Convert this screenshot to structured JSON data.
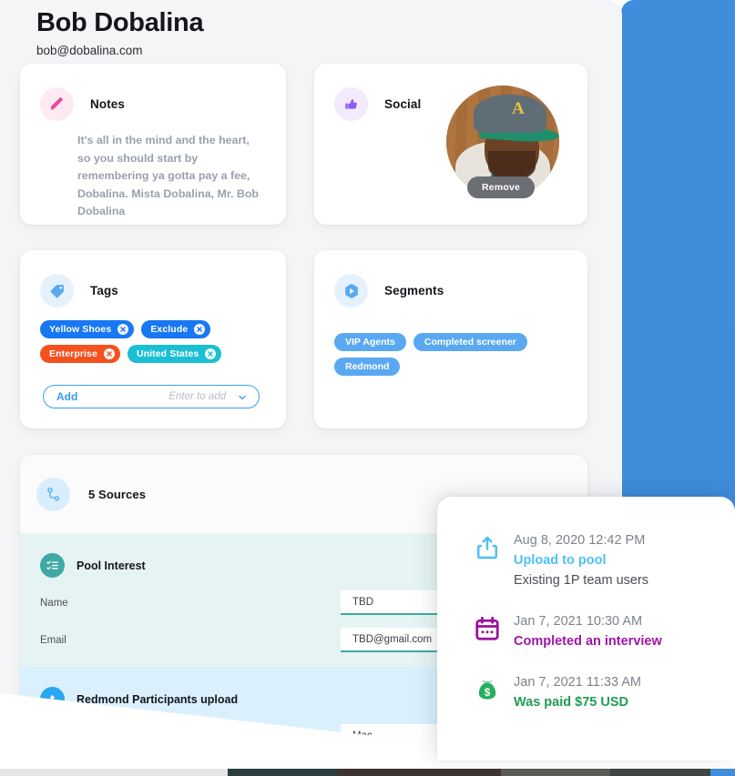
{
  "header": {
    "name": "Bob Dobalina",
    "email": "bob@dobalina.com"
  },
  "cards": {
    "notes": {
      "icon": "pencil-icon",
      "label": "Notes",
      "body": "It's all in the mind and the heart, so you should start by remembering ya gotta pay a fee, Dobalina. Mista Dobalina, Mr. Bob Dobalina"
    },
    "social": {
      "icon": "thumbs-up-icon",
      "label": "Social",
      "remove_label": "Remove",
      "avatar_alt": "profile-photo"
    },
    "tags": {
      "icon": "tag-icon",
      "label": "Tags",
      "items": [
        {
          "label": "Yellow Shoes",
          "color": "#1877f2"
        },
        {
          "label": "Exclude",
          "color": "#1877f2"
        },
        {
          "label": "Enterprise",
          "color": "#f4511e"
        },
        {
          "label": "United States",
          "color": "#1bbfd4"
        }
      ],
      "add_label": "Add",
      "add_placeholder": "Enter to add"
    },
    "segments": {
      "icon": "hexagon-play-icon",
      "label": "Segments",
      "color": "#5aa9f0",
      "items": [
        "VIP Agents",
        "Completed screener",
        "Redmond"
      ]
    }
  },
  "sources": {
    "icon": "branch-icon",
    "title": "5 Sources",
    "sections": [
      {
        "icon": "checklist-icon",
        "title": "Pool Interest",
        "accent": "#3fa9a3",
        "fields": [
          {
            "label": "Name",
            "value": "TBD"
          },
          {
            "label": "Email",
            "value": "TBD@gmail.com"
          }
        ]
      },
      {
        "icon": "upload-circle-icon",
        "title": "Redmond Participants upload",
        "accent": "#2ba6f0",
        "fields": [
          {
            "label": "",
            "value": "Mac"
          }
        ]
      }
    ]
  },
  "timeline": {
    "events": [
      {
        "icon": "share-upload-icon",
        "icon_color": "#4fc0f5",
        "time": "Aug 8, 2020 12:42 PM",
        "action": "Upload to pool",
        "action_color": "#4fc0f5",
        "note": "Existing 1P team users"
      },
      {
        "icon": "calendar-icon",
        "icon_color": "#9c0f9c",
        "time": "Jan 7, 2021 10:30 AM",
        "action": "Completed an interview",
        "action_color": "#a015a8",
        "note": ""
      },
      {
        "icon": "money-bag-icon",
        "icon_color": "#27ae60",
        "time": "Jan 7, 2021 11:33 AM",
        "action": "Was paid $75 USD",
        "action_color": "#1f9d55",
        "note": ""
      }
    ]
  },
  "chrome": {
    "blue_panel_color": "#3f8ddb",
    "taskbar_segments": [
      "#e6e6e6",
      "#2b3d3f",
      "#3c3230",
      "#5c5a55",
      "#3f4540",
      "#3f8ddb"
    ]
  }
}
